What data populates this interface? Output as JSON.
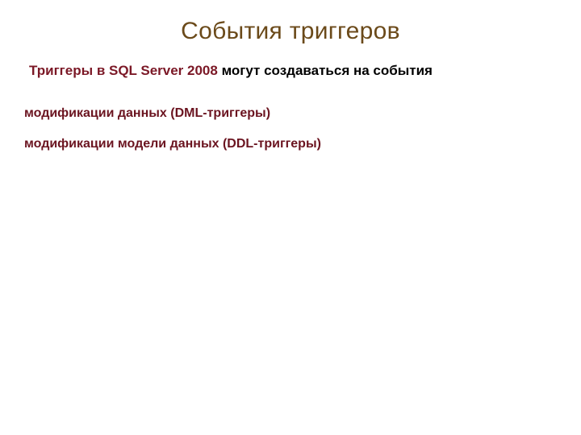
{
  "title": "События триггеров",
  "intro": {
    "highlight": "Триггеры в SQL Server 2008 ",
    "rest": " могут создаваться на события"
  },
  "bullets": [
    "модификации данных (DML-триггеры)",
    "модификации модели данных (DDL-триггеры)"
  ]
}
